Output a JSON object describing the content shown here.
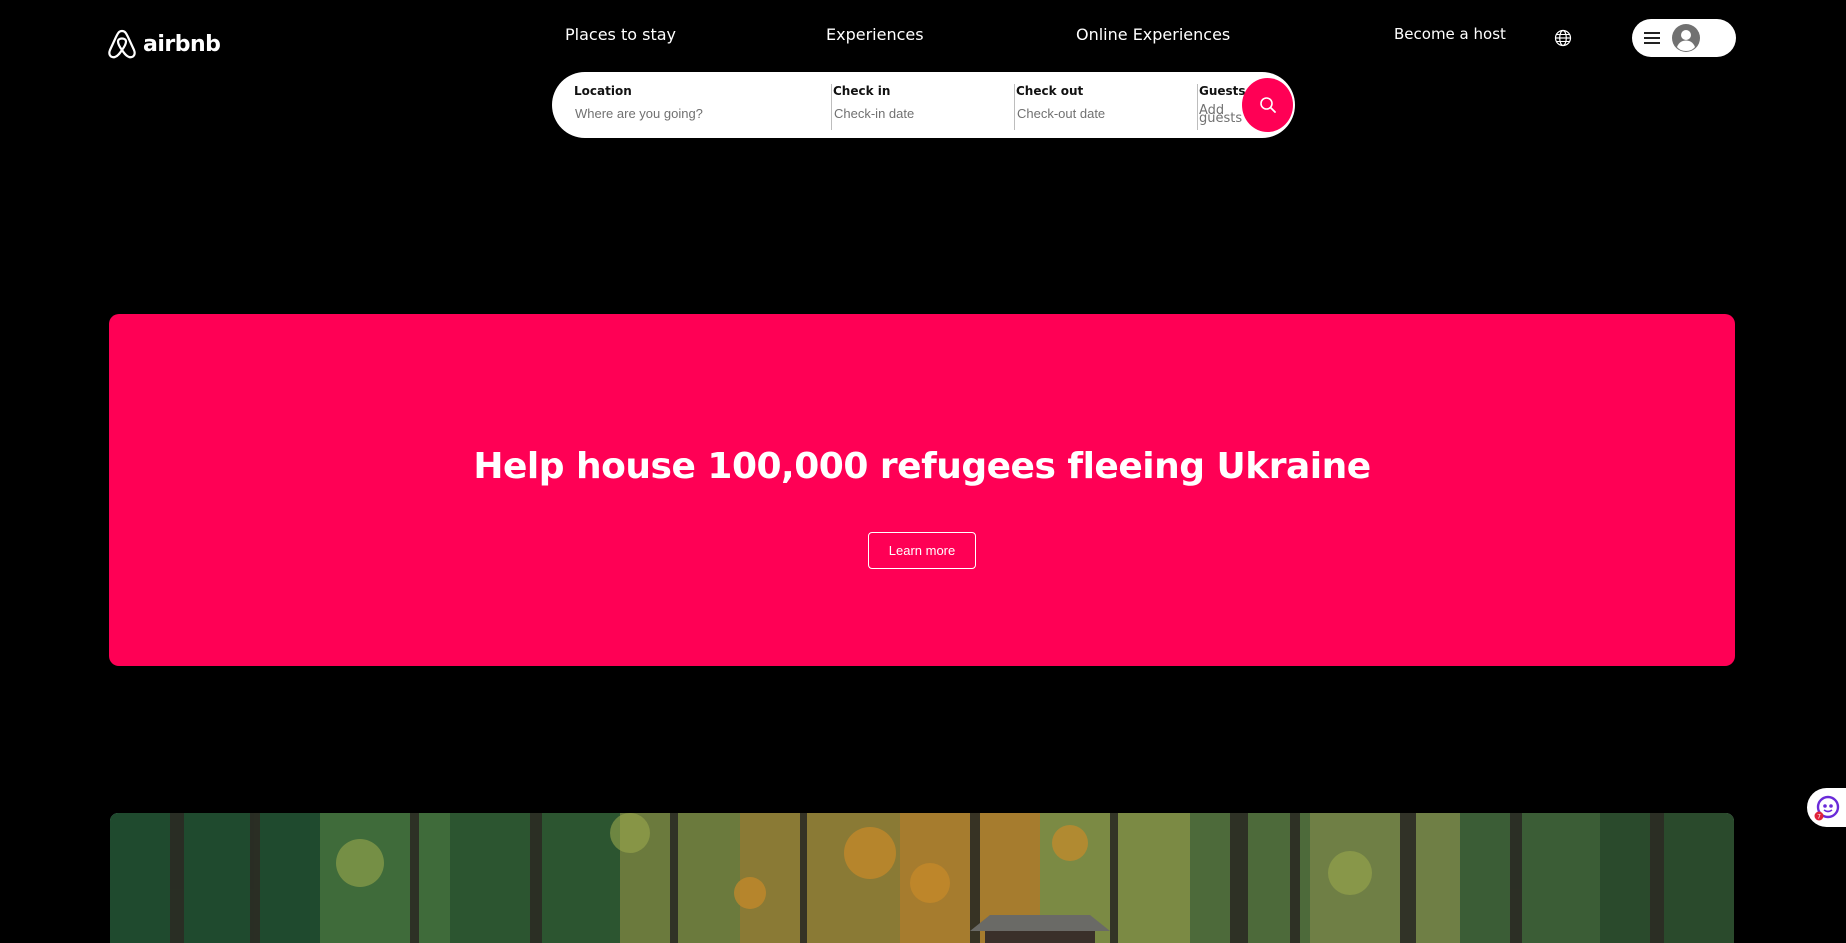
{
  "header": {
    "logo": {
      "text": "airbnb",
      "icon": "airbnb-belo-icon"
    },
    "nav": [
      "Places to stay",
      "Experiences",
      "Online Experiences"
    ],
    "become_host": "Become a host",
    "globe_icon": "globe-icon",
    "menu_icon": "hamburger-menu-icon",
    "avatar_icon": "user-avatar-icon"
  },
  "search": {
    "location": {
      "label": "Location",
      "placeholder": "Where are you going?"
    },
    "check_in": {
      "label": "Check in",
      "placeholder": "Check-in date"
    },
    "check_out": {
      "label": "Check out",
      "placeholder": "Check-out date"
    },
    "guests": {
      "label": "Guests",
      "placeholder": "Add guests"
    },
    "button_icon": "search-icon"
  },
  "banner": {
    "title": "Help house 100,000 refugees fleeing Ukraine",
    "button": "Learn more",
    "color": "#ff0055"
  },
  "hero": {
    "image": "forest-cabin-photo"
  },
  "assistant": {
    "icon": "assistant-bot-icon",
    "badge_color": "#e0223a"
  },
  "colors": {
    "background": "#000000",
    "accent": "#ff0055"
  }
}
